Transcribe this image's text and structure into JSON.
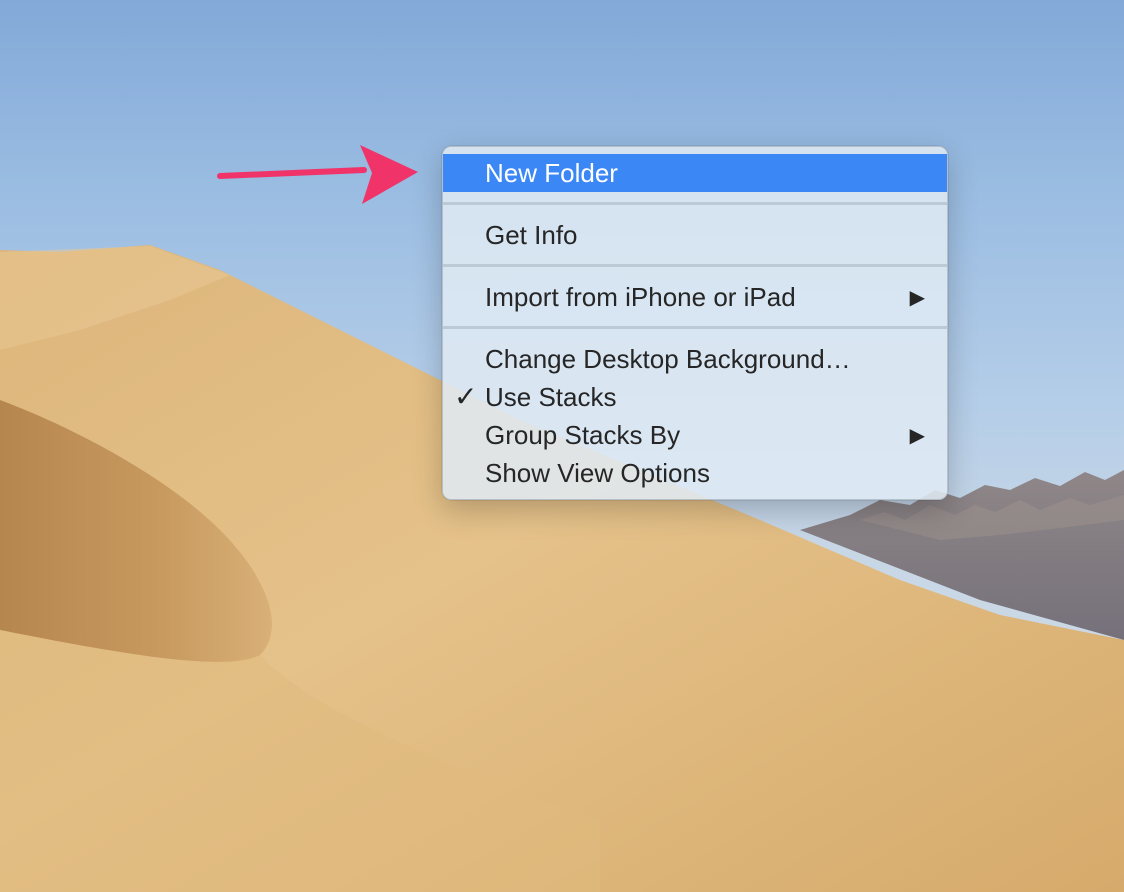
{
  "menu": {
    "items": [
      {
        "label": "New Folder",
        "highlighted": true
      },
      {
        "separator": true
      },
      {
        "label": "Get Info"
      },
      {
        "separator": true
      },
      {
        "label": "Import from iPhone or iPad",
        "submenu": true,
        "submenu_glyph": "▶"
      },
      {
        "separator": true
      },
      {
        "label": "Change Desktop Background…"
      },
      {
        "label": "Use Stacks",
        "checked": true,
        "check_glyph": "✓"
      },
      {
        "label": "Group Stacks By",
        "submenu": true,
        "submenu_glyph": "▶"
      },
      {
        "label": "Show View Options"
      }
    ],
    "highlight_color": "#3b87f5"
  },
  "annotation": {
    "arrow_color": "#f0346a"
  },
  "icons": {
    "checkmark": "checkmark-icon",
    "submenu": "submenu-arrow-icon"
  }
}
